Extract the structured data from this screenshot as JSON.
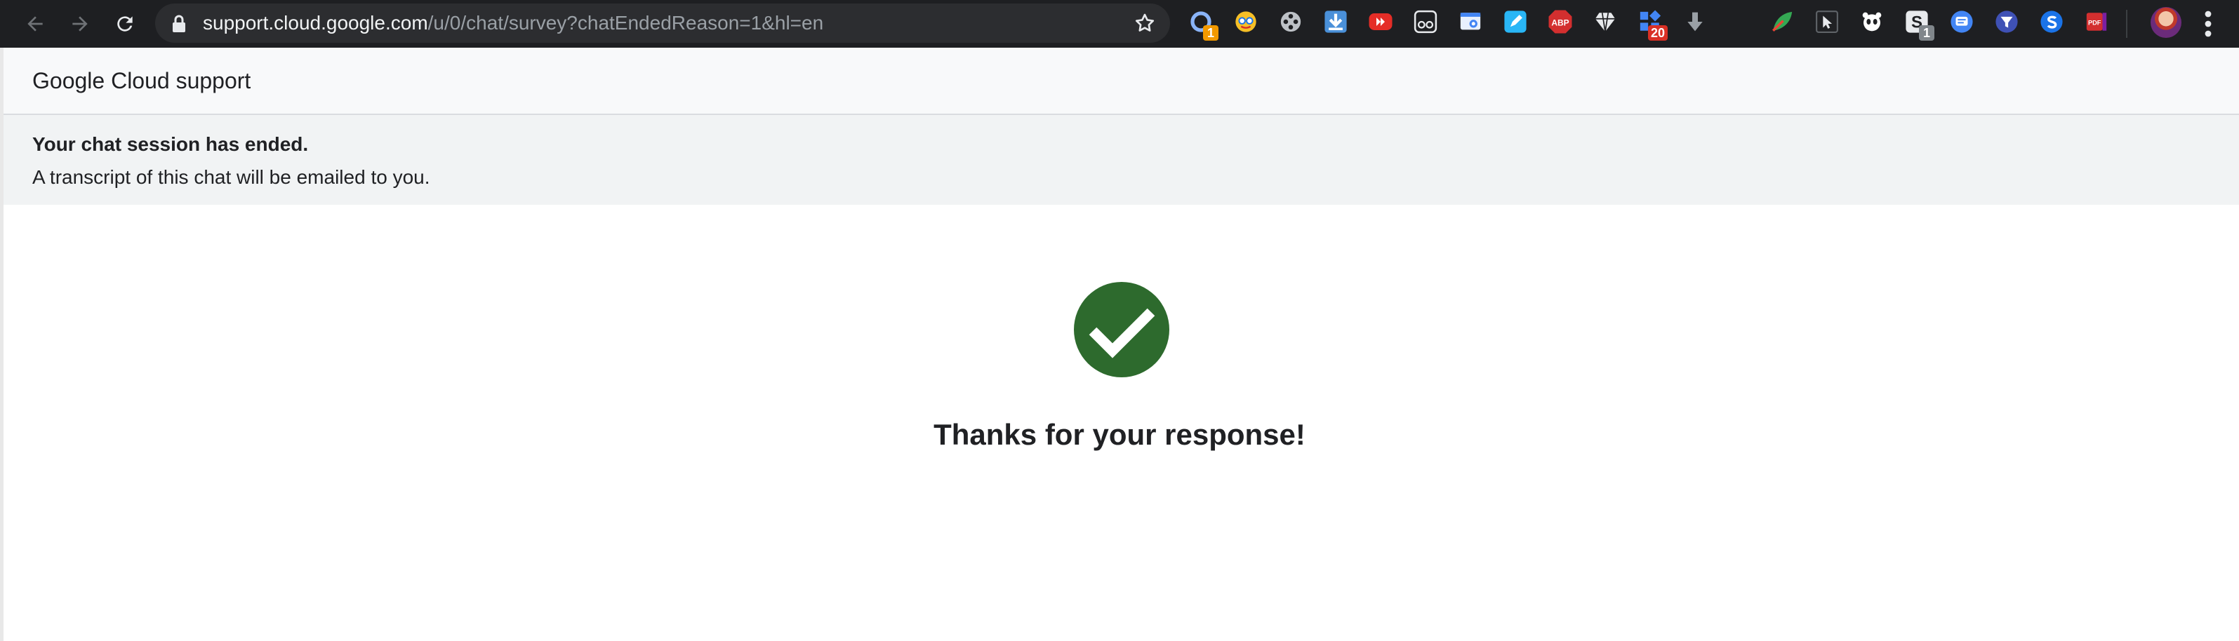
{
  "browser": {
    "url_host": "support.cloud.google.com",
    "url_path": "/u/0/chat/survey?chatEndedReason=1&hl=en",
    "extension_badges": {
      "first": "1",
      "grid": "20",
      "s_ext": "1"
    },
    "colors": {
      "toolbar_bg": "#1e1f22",
      "omnibox_bg": "#2c2d30"
    }
  },
  "header": {
    "title": "Google Cloud support"
  },
  "banner": {
    "title": "Your chat session has ended.",
    "text": "A transcript of this chat will be emailed to you."
  },
  "main": {
    "confirmation_icon": "check-circle-icon",
    "message": "Thanks for your response!",
    "accent_color": "#2d6a2d"
  }
}
